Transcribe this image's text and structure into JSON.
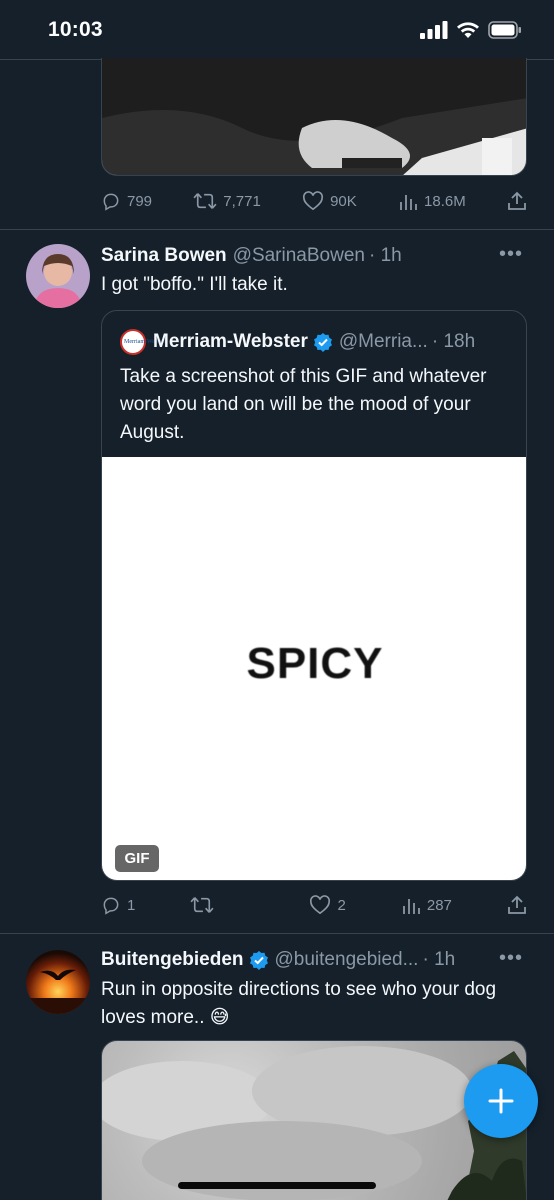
{
  "status_bar": {
    "time": "10:03"
  },
  "tweet1": {
    "actions": {
      "replies": "799",
      "retweets": "7,771",
      "likes": "90K",
      "views": "18.6M"
    }
  },
  "tweet2": {
    "author": "Sarina Bowen",
    "handle": "@SarinaBowen",
    "time": "· 1h",
    "text": "I got \"boffo.\" I'll take it.",
    "quote": {
      "author": "Merriam-Webster",
      "handle": "@Merria...",
      "time": "· 18h",
      "logo_text": "Merriam-Webster",
      "text": "Take a screenshot of this GIF and whatever word you land on will be the mood of your August.",
      "gif_word": "SPICY",
      "gif_badge": "GIF"
    },
    "actions": {
      "replies": "1",
      "retweets": "",
      "likes": "2",
      "views": "287"
    }
  },
  "tweet3": {
    "author": "Buitengebieden",
    "handle": "@buitengebied...",
    "time": "· 1h",
    "text": "Run in opposite directions to see who your dog loves more.. 😅"
  },
  "colors": {
    "background": "#15202b",
    "accent": "#1d9bf0",
    "muted": "#8b98a5",
    "border": "#38444d"
  }
}
